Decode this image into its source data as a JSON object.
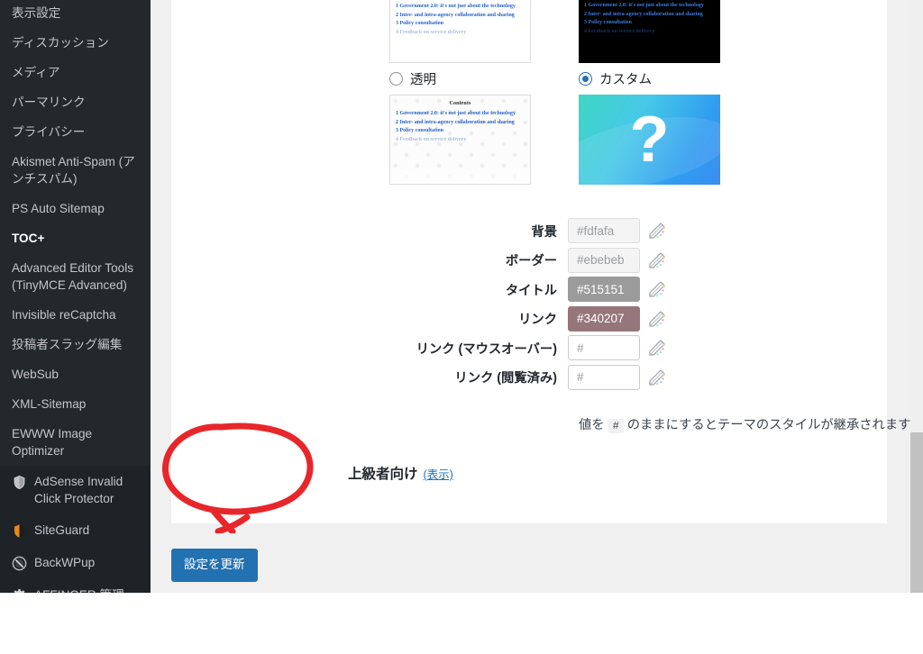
{
  "sidebar": {
    "groups": [
      {
        "style": "normal",
        "items": [
          {
            "label": "表示設定",
            "icon": null,
            "current": false
          },
          {
            "label": "ディスカッション",
            "icon": null,
            "current": false
          },
          {
            "label": "メディア",
            "icon": null,
            "current": false
          },
          {
            "label": "パーマリンク",
            "icon": null,
            "current": false
          },
          {
            "label": "プライバシー",
            "icon": null,
            "current": false
          },
          {
            "label": "Akismet Anti-Spam (アンチスパム)",
            "icon": null,
            "current": false
          },
          {
            "label": "PS Auto Sitemap",
            "icon": null,
            "current": false
          },
          {
            "label": "TOC+",
            "icon": null,
            "current": true
          },
          {
            "label": "Advanced Editor Tools (TinyMCE Advanced)",
            "icon": null,
            "current": false
          },
          {
            "label": "Invisible reCaptcha",
            "icon": null,
            "current": false
          },
          {
            "label": "投稿者スラッグ編集",
            "icon": null,
            "current": false
          },
          {
            "label": "WebSub",
            "icon": null,
            "current": false
          },
          {
            "label": "XML-Sitemap",
            "icon": null,
            "current": false
          },
          {
            "label": "EWWW Image Optimizer",
            "icon": null,
            "current": false
          }
        ]
      },
      {
        "style": "dark",
        "items": [
          {
            "label": "AdSense Invalid Click Protector",
            "icon": "shield-icon",
            "current": false
          },
          {
            "label": "SiteGuard",
            "icon": "siteguard-shield-icon",
            "current": false
          },
          {
            "label": "BackWPup",
            "icon": "backwpup-disc-icon",
            "current": false
          },
          {
            "label": "AFFINGER 管理",
            "icon": "gear-icon",
            "current": false
          }
        ]
      }
    ]
  },
  "main": {
    "thumbnails_top": {
      "light": {
        "lines": [
          "1 Government 2.0: it's not just about the technology",
          "2 Inter- and intra-agency collaboration and sharing",
          "3 Policy consultation",
          "4 Feedback on service delivery"
        ]
      },
      "dark": {
        "lines": [
          "1 Government 2.0: it's not just about the technology",
          "2 Inter- and intra-agency collaboration and sharing",
          "3 Policy consultation",
          "4 Feedback on service delivery"
        ]
      }
    },
    "options": [
      {
        "name": "transparent",
        "label": "透明",
        "checked": false,
        "thumb_kind": "pattern",
        "thumb_title": "Contents",
        "thumb_lines": [
          "1 Government 2.0: it's not just about the technology",
          "2 Inter- and intra-agency collaboration and sharing",
          "3 Policy consultation",
          "4 Feedback on service delivery"
        ]
      },
      {
        "name": "custom",
        "label": "カスタム",
        "checked": true,
        "thumb_kind": "custom",
        "thumb_glyph": "?"
      }
    ],
    "color_fields": [
      {
        "label": "背景",
        "value": "#fdfafa",
        "state": "tinted",
        "icon": "color-picker-icon"
      },
      {
        "label": "ボーダー",
        "value": "#ebebeb",
        "state": "tinted",
        "icon": "color-picker-icon"
      },
      {
        "label": "タイトル",
        "value": "#515151",
        "state": "filled-grey",
        "icon": "color-picker-icon"
      },
      {
        "label": "リンク",
        "value": "#340207",
        "state": "filled-mauve",
        "icon": "color-picker-icon"
      },
      {
        "label": "リンク (マウスオーバー)",
        "value": "#",
        "state": "empty",
        "icon": "color-picker-icon"
      },
      {
        "label": "リンク (閲覧済み)",
        "value": "#",
        "state": "empty",
        "icon": "color-picker-icon"
      }
    ],
    "hint": {
      "before": "値を",
      "code": "#",
      "after": "のままにするとテーマのスタイルが継承されます"
    },
    "advanced": {
      "title": "上級者向け",
      "toggle": "(表示)"
    },
    "submit_label": "設定を更新"
  },
  "colors": {
    "accent": "#2271b1",
    "sidebar_bg": "#23282d",
    "sidebar_bg_dark": "#1d2327",
    "page_bg": "#f0f0f1",
    "annotation": "#e8262a",
    "title_swatch": "#9b9b9b",
    "link_swatch": "#96767a"
  }
}
